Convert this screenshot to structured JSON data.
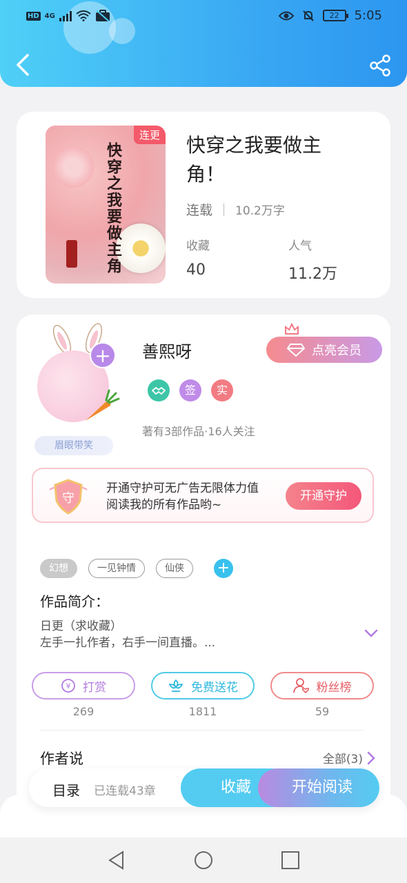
{
  "status_bar": {
    "hd": "HD",
    "network": "4G",
    "battery": "22",
    "time": "5:05"
  },
  "header": {
    "back_icon": "chevron-left-icon",
    "share_icon": "share-icon"
  },
  "book": {
    "ongoing_tag": "连更",
    "title": "快穿之我要做主角！",
    "cover_title": "快穿之我要做主角",
    "status": "连载",
    "word_count": "10.2万字",
    "favorites_label": "收藏",
    "favorites_value": "40",
    "popularity_label": "人气",
    "popularity_value": "11.2万"
  },
  "author": {
    "name": "善熙呀",
    "nickname_badge": "眉眼带笑",
    "vip_button": "点亮会员",
    "badges": [
      {
        "label": "",
        "color": "#3cc6a7",
        "icon": "handshake-icon"
      },
      {
        "label": "签",
        "color": "#c08be8"
      },
      {
        "label": "实",
        "color": "#f27b83"
      }
    ],
    "meta": "著有3部作品·16人关注"
  },
  "guard": {
    "icon_text": "守",
    "text_line1": "开通守护可无广告无限体力值",
    "text_line2": "阅读我的所有作品哟~",
    "button": "开通守护"
  },
  "tags": [
    "幻想",
    "一见钟情",
    "仙侠"
  ],
  "intro": {
    "label": "作品简介：",
    "line1": "日更（求收藏）",
    "line2": "左手一扎作者，右手一间直播。..."
  },
  "actions": [
    {
      "label": "打赏",
      "count": "269",
      "icon": "coin-icon"
    },
    {
      "label": "免费送花",
      "count": "1811",
      "icon": "flower-icon"
    },
    {
      "label": "粉丝榜",
      "count": "59",
      "icon": "fan-icon"
    }
  ],
  "author_says": {
    "label": "作者说",
    "all_link": "全部(3)"
  },
  "bottom_bar": {
    "catalog": "目录",
    "chapters": "已连载43章",
    "collect": "收藏",
    "read": "开始阅读"
  },
  "colors": {
    "header_start": "#4fd0f7",
    "header_end": "#2c96f0",
    "accent_purple": "#b889e8",
    "accent_pink": "#f4577a"
  }
}
